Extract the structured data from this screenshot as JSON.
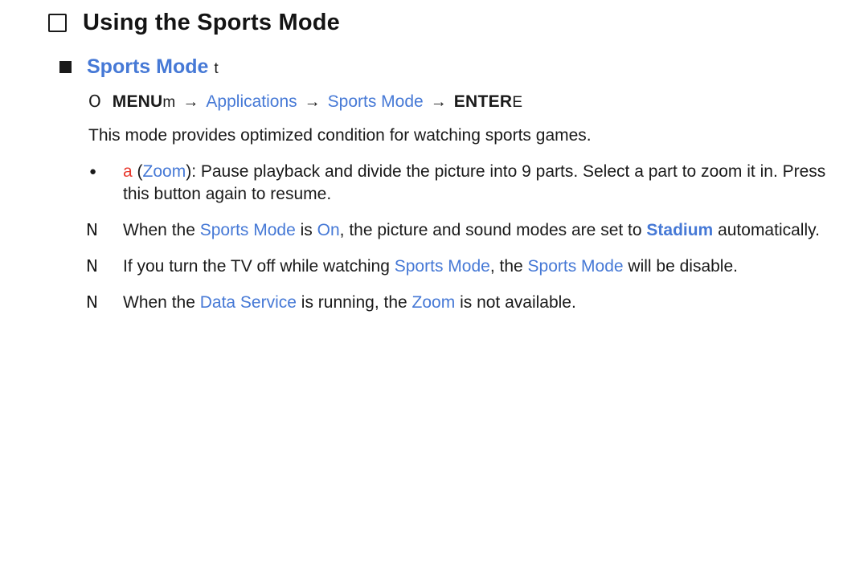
{
  "page": {
    "title": "Using the Sports Mode",
    "section": {
      "label": "Sports Mode",
      "suffix": "t"
    },
    "menu_path": {
      "glyph": "O",
      "menu_label": "MENU",
      "menu_suffix": "m",
      "arrow": "→",
      "step1": "Applications",
      "step2": "Sports Mode",
      "enter_label": "ENTER",
      "enter_suffix": "E"
    },
    "intro": "This mode provides optimized condition for watching sports games.",
    "notes": [
      {
        "marker": "●",
        "marker_type": "dot",
        "parts": [
          {
            "text": "a",
            "style": "red"
          },
          {
            "text": " (",
            "style": "plain"
          },
          {
            "text": "Zoom",
            "style": "blue"
          },
          {
            "text": "): Pause playback and divide the picture into 9 parts. Select a part to zoom it in. Press this button again to resume.",
            "style": "plain"
          }
        ]
      },
      {
        "marker": "N",
        "marker_type": "n",
        "parts": [
          {
            "text": "When the ",
            "style": "plain"
          },
          {
            "text": "Sports Mode",
            "style": "blue"
          },
          {
            "text": " is ",
            "style": "plain"
          },
          {
            "text": "On",
            "style": "blue"
          },
          {
            "text": ", the picture and sound modes are set to ",
            "style": "plain"
          },
          {
            "text": "Stadium",
            "style": "blue-b"
          },
          {
            "text": " automatically.",
            "style": "plain"
          }
        ]
      },
      {
        "marker": "N",
        "marker_type": "n",
        "parts": [
          {
            "text": "If you turn the TV off while watching ",
            "style": "plain"
          },
          {
            "text": "Sports Mode",
            "style": "blue"
          },
          {
            "text": ", the ",
            "style": "plain"
          },
          {
            "text": "Sports Mode",
            "style": "blue"
          },
          {
            "text": " will be disable.",
            "style": "plain"
          }
        ]
      },
      {
        "marker": "N",
        "marker_type": "n",
        "parts": [
          {
            "text": "When the ",
            "style": "plain"
          },
          {
            "text": "Data Service",
            "style": "blue"
          },
          {
            "text": " is running, the ",
            "style": "plain"
          },
          {
            "text": "Zoom",
            "style": "blue"
          },
          {
            "text": " is not available.",
            "style": "plain"
          }
        ]
      }
    ],
    "colors": {
      "accent_blue": "#4679d6",
      "accent_red": "#e8382d",
      "text": "#1a1a1a",
      "background": "#ffffff"
    }
  }
}
